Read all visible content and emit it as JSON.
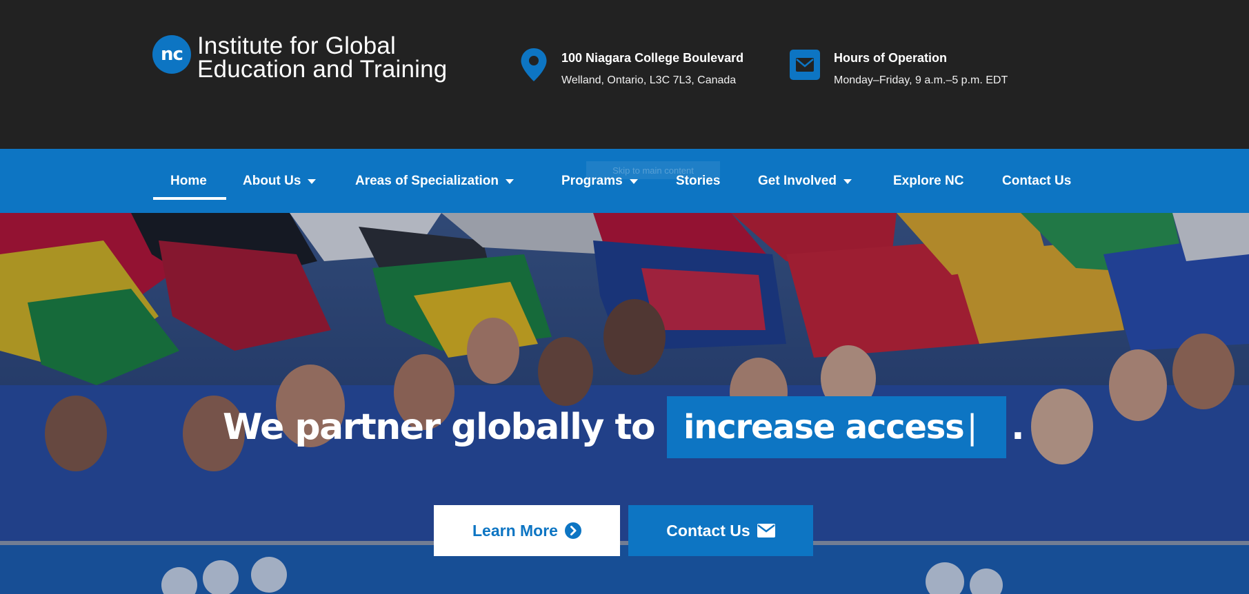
{
  "header": {
    "logo_badge": "nc",
    "logo_line1": "Institute for Global",
    "logo_line2": "Education and Training",
    "address": {
      "icon": "map-pin-icon",
      "title": "100 Niagara College Boulevard",
      "subtitle": "Welland, Ontario, L3C 7L3, Canada"
    },
    "hours": {
      "icon": "envelope-icon",
      "title": "Hours of Operation",
      "subtitle": "Monday–Friday, 9 a.m.–5 p.m. EDT"
    }
  },
  "nav": {
    "skip_link": "Skip to main content",
    "items": [
      {
        "label": "Home",
        "active": true,
        "dropdown": false
      },
      {
        "label": "About Us",
        "active": false,
        "dropdown": true
      },
      {
        "label": "Areas of Specialization",
        "active": false,
        "dropdown": true
      },
      {
        "label": "Programs",
        "active": false,
        "dropdown": true
      },
      {
        "label": "Stories",
        "active": false,
        "dropdown": false
      },
      {
        "label": "Get Involved",
        "active": false,
        "dropdown": true
      },
      {
        "label": "Explore NC",
        "active": false,
        "dropdown": false
      },
      {
        "label": "Contact Us",
        "active": false,
        "dropdown": false
      }
    ]
  },
  "hero": {
    "headline_static": "We partner globally to",
    "headline_rotating": "increase access",
    "cursor": "|",
    "headline_end": ".",
    "buttons": [
      {
        "label": "Learn More",
        "icon": "chevron-circle-right-icon"
      },
      {
        "label": "Contact Us",
        "icon": "envelope-icon"
      }
    ]
  },
  "colors": {
    "brand_blue": "#0d75c3",
    "header_bg": "#222222",
    "white": "#ffffff"
  }
}
